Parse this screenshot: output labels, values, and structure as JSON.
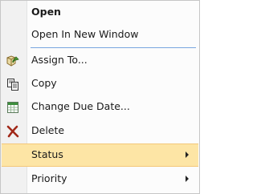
{
  "context_menu": {
    "items": [
      {
        "label": "Open",
        "icon": "none",
        "bold": true
      },
      {
        "label": "Open In New Window",
        "icon": "none"
      },
      {
        "label": "Assign To...",
        "icon": "assign-icon"
      },
      {
        "label": "Copy",
        "icon": "copy-icon"
      },
      {
        "label": "Change Due Date...",
        "icon": "calendar-icon"
      },
      {
        "label": "Delete",
        "icon": "delete-icon"
      },
      {
        "label": "Status",
        "icon": "none",
        "submenu": true,
        "highlighted": true
      },
      {
        "label": "Priority",
        "icon": "none",
        "submenu": true
      }
    ],
    "colors": {
      "highlight_fill": "#fde5a5",
      "highlight_border": "#f4c779",
      "separator": "#79a6e0",
      "delete_icon": "#a12818"
    }
  }
}
